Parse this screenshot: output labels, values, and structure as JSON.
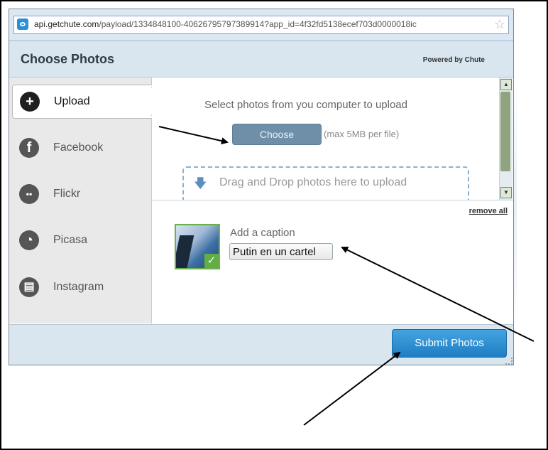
{
  "browser": {
    "url_host": "api.getchute.com",
    "url_rest": "/payload/1334848100-40626795797389914?app_id=4f32fd5138ecef703d0000018ic",
    "favicon_icon": "chute-favicon-icon",
    "bookmark_icon": "star-icon"
  },
  "dialog": {
    "title": "Choose Photos",
    "powered_by": "Powered by Chute"
  },
  "sidebar": {
    "items": [
      {
        "label": "Upload",
        "icon": "plus-icon",
        "glyph": "+"
      },
      {
        "label": "Facebook",
        "icon": "facebook-icon",
        "glyph": "f"
      },
      {
        "label": "Flickr",
        "icon": "flickr-icon",
        "glyph": "••"
      },
      {
        "label": "Picasa",
        "icon": "picasa-icon",
        "glyph": "◔"
      },
      {
        "label": "Instagram",
        "icon": "instagram-icon",
        "glyph": "▤"
      }
    ]
  },
  "upload": {
    "instruction": "Select photos from you computer to upload",
    "choose_label": "Choose",
    "max_note": "(max 5MB per file)",
    "drop_text": "Drag and Drop photos here to upload",
    "drop_icon": "down-arrow-icon"
  },
  "queue": {
    "remove_all": "remove all",
    "caption_label": "Add a caption",
    "caption_value": "Putin en un cartel"
  },
  "footer": {
    "submit_label": "Submit Photos"
  },
  "colors": {
    "accent": "#2b8fd6",
    "check": "#62ad45",
    "header_bg": "#d9e6ef"
  }
}
